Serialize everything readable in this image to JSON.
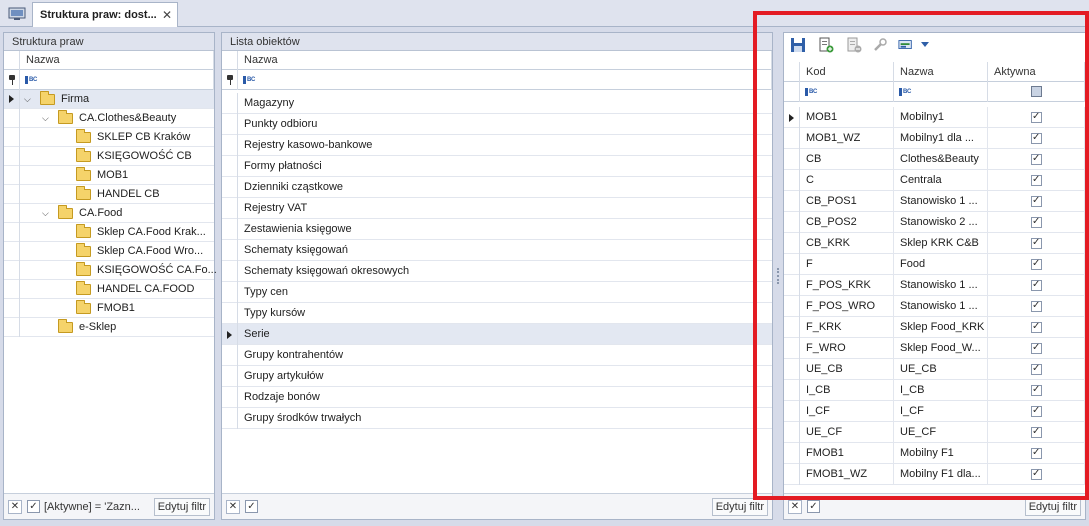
{
  "tab": {
    "title": "Struktura praw: dost...",
    "close": "✕"
  },
  "left": {
    "title": "Struktura praw",
    "col_header": "Nazwa",
    "filter_text": "[Aktywne] = 'Zazn...",
    "edit_filter": "Edytuj filtr",
    "tree": [
      {
        "label": "Firma",
        "level": 0,
        "expanded": true,
        "selected": true
      },
      {
        "label": "CA.Clothes&Beauty",
        "level": 1,
        "expanded": true
      },
      {
        "label": "SKLEP CB Kraków",
        "level": 2
      },
      {
        "label": "KSIĘGOWOŚĆ CB",
        "level": 2
      },
      {
        "label": "MOB1",
        "level": 2
      },
      {
        "label": "HANDEL CB",
        "level": 2
      },
      {
        "label": "CA.Food",
        "level": 1,
        "expanded": true
      },
      {
        "label": "Sklep CA.Food Krak...",
        "level": 2
      },
      {
        "label": "Sklep CA.Food Wro...",
        "level": 2
      },
      {
        "label": "KSIĘGOWOŚĆ CA.Fo...",
        "level": 2
      },
      {
        "label": "HANDEL CA.FOOD",
        "level": 2
      },
      {
        "label": "FMOB1",
        "level": 2
      },
      {
        "label": "e-Sklep",
        "level": 1
      }
    ]
  },
  "middle": {
    "title": "Lista obiektów",
    "col_header": "Nazwa",
    "edit_filter": "Edytuj filtr",
    "items": [
      "Magazyny",
      "Punkty odbioru",
      "Rejestry kasowo-bankowe",
      "Formy płatności",
      "Dzienniki cząstkowe",
      "Rejestry VAT",
      "Zestawienia księgowe",
      "Schematy księgowań",
      "Schematy księgowań okresowych",
      "Typy cen",
      "Typy kursów",
      "Serie",
      "Grupy kontrahentów",
      "Grupy artykułów",
      "Rodzaje bonów",
      "Grupy środków trwałych"
    ],
    "selected_index": 11
  },
  "right": {
    "headers": {
      "kod": "Kod",
      "nazwa": "Nazwa",
      "aktywna": "Aktywna"
    },
    "edit_filter": "Edytuj filtr",
    "toolbar_icons": [
      "save-icon",
      "add-icon",
      "delete-icon",
      "wrench-icon",
      "export-icon",
      "dropdown-arrow-icon"
    ],
    "rows": [
      {
        "kod": "MOB1",
        "nazwa": "Mobilny1",
        "aktywna": true
      },
      {
        "kod": "MOB1_WZ",
        "nazwa": "Mobilny1 dla ...",
        "aktywna": true
      },
      {
        "kod": "CB",
        "nazwa": "Clothes&Beauty",
        "aktywna": true
      },
      {
        "kod": "C",
        "nazwa": "Centrala",
        "aktywna": true
      },
      {
        "kod": "CB_POS1",
        "nazwa": "Stanowisko 1 ...",
        "aktywna": true
      },
      {
        "kod": "CB_POS2",
        "nazwa": "Stanowisko 2 ...",
        "aktywna": true
      },
      {
        "kod": "CB_KRK",
        "nazwa": "Sklep KRK C&B",
        "aktywna": true
      },
      {
        "kod": "F",
        "nazwa": "Food",
        "aktywna": true
      },
      {
        "kod": "F_POS_KRK",
        "nazwa": "Stanowisko 1 ...",
        "aktywna": true
      },
      {
        "kod": "F_POS_WRO",
        "nazwa": "Stanowisko 1 ...",
        "aktywna": true
      },
      {
        "kod": "F_KRK",
        "nazwa": "Sklep Food_KRK",
        "aktywna": true
      },
      {
        "kod": "F_WRO",
        "nazwa": "Sklep Food_W...",
        "aktywna": true
      },
      {
        "kod": "UE_CB",
        "nazwa": "UE_CB",
        "aktywna": true
      },
      {
        "kod": "I_CB",
        "nazwa": "I_CB",
        "aktywna": true
      },
      {
        "kod": "I_CF",
        "nazwa": "I_CF",
        "aktywna": true
      },
      {
        "kod": "UE_CF",
        "nazwa": "UE_CF",
        "aktywna": true
      },
      {
        "kod": "FMOB1",
        "nazwa": "Mobilny F1",
        "aktywna": true
      },
      {
        "kod": "FMOB1_WZ",
        "nazwa": "Mobilny F1 dla...",
        "aktywna": true
      }
    ]
  },
  "colors": {
    "highlight_frame": "#e31b23",
    "selected_row": "#e3e8f2",
    "panel_border": "#a8b4c8"
  }
}
